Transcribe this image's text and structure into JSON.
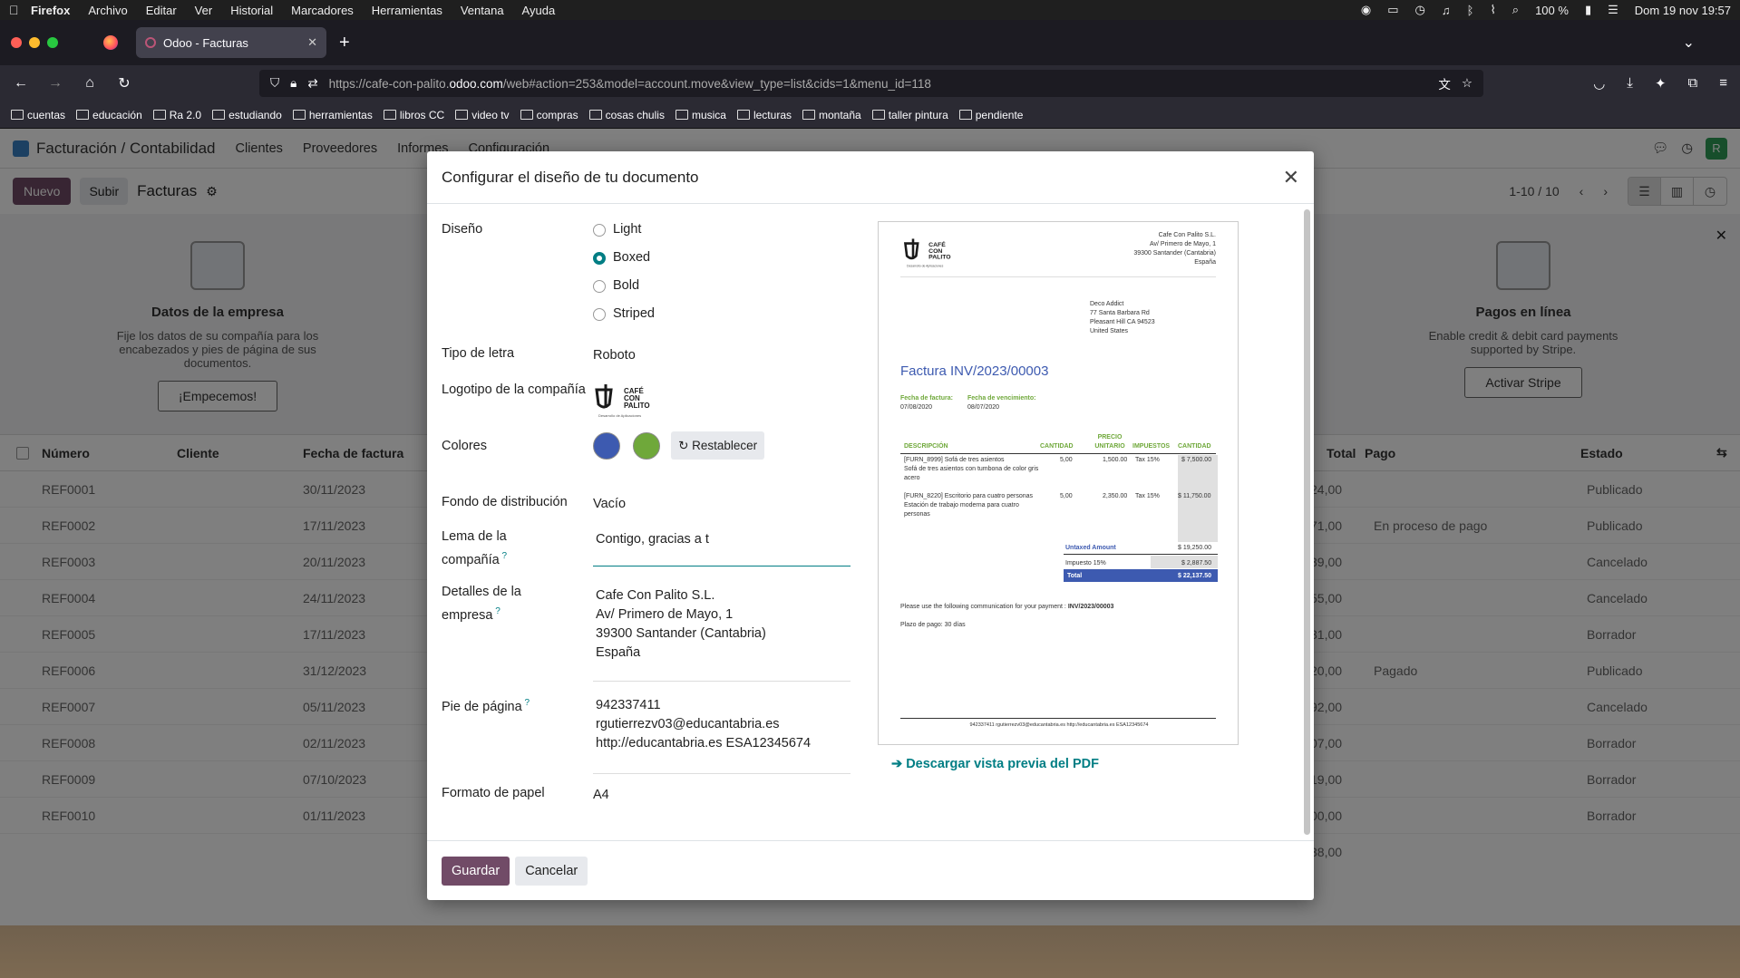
{
  "menubar": {
    "app": "Firefox",
    "items": [
      "Archivo",
      "Editar",
      "Ver",
      "Historial",
      "Marcadores",
      "Herramientas",
      "Ventana",
      "Ayuda"
    ],
    "battery": "100 %",
    "datetime": "Dom 19 nov  19:57"
  },
  "browser": {
    "tab_title": "Odoo - Facturas",
    "url_prefix": "https://cafe-con-palito.",
    "url_host": "odoo.com",
    "url_rest": "/web#action=253&model=account.move&view_type=list&cids=1&menu_id=118",
    "bookmarks": [
      "cuentas",
      "educación",
      "Ra 2.0",
      "estudiando",
      "herramientas",
      "libros CC",
      "video tv",
      "compras",
      "cosas chulis",
      "musica",
      "lecturas",
      "montaña",
      "taller pintura",
      "pendiente"
    ]
  },
  "odoo": {
    "app_title": "Facturación / Contabilidad",
    "menu": [
      "Clientes",
      "Proveedores",
      "Informes",
      "Configuración"
    ],
    "avatar": "R",
    "new_label": "Nuevo",
    "upload_label": "Subir",
    "view_title": "Facturas",
    "pager": "1-10 / 10",
    "onboarding": {
      "company_title": "Datos de la empresa",
      "company_text": "Fije los datos de su compañía para los encabezados y pies de página de sus documentos.",
      "company_button": "¡Empecemos!",
      "payments_title": "Pagos en línea",
      "payments_text": "Enable credit & debit card payments supported by Stripe.",
      "payments_button": "Activar Stripe"
    },
    "columns": {
      "number": "Número",
      "customer": "Cliente",
      "date": "Fecha de factura",
      "total": "Total",
      "payment": "Pago",
      "state": "Estado"
    },
    "rows": [
      {
        "ref": "REF0001",
        "date": "30/11/2023",
        "total": "24,00",
        "state": "Publicado"
      },
      {
        "ref": "REF0002",
        "date": "17/11/2023",
        "total": "71,00",
        "state": "Publicado",
        "payment": "En proceso de pago"
      },
      {
        "ref": "REF0003",
        "date": "20/11/2023",
        "total": "39,00",
        "state": "Cancelado"
      },
      {
        "ref": "REF0004",
        "date": "24/11/2023",
        "total": "55,00",
        "state": "Cancelado"
      },
      {
        "ref": "REF0005",
        "date": "17/11/2023",
        "total": "31,00",
        "state": "Borrador"
      },
      {
        "ref": "REF0006",
        "date": "31/12/2023",
        "total": "20,00",
        "state": "Publicado",
        "payment": "Pagado"
      },
      {
        "ref": "REF0007",
        "date": "05/11/2023",
        "total": "92,00",
        "state": "Cancelado"
      },
      {
        "ref": "REF0008",
        "date": "02/11/2023",
        "total": "07,00",
        "state": "Borrador"
      },
      {
        "ref": "REF0009",
        "date": "07/10/2023",
        "total": "19,00",
        "state": "Borrador"
      },
      {
        "ref": "REF0010",
        "date": "01/11/2023",
        "total": "00,00",
        "state": "Borrador"
      }
    ],
    "sum_total": "38,00"
  },
  "modal": {
    "title": "Configurar el diseño de tu documento",
    "labels": {
      "design": "Diseño",
      "font": "Tipo de letra",
      "logo": "Logotipo de la compañía",
      "colors": "Colores",
      "layout_bg": "Fondo de distribución",
      "tagline": "Lema de la compañía",
      "company_details": "Detalles de la empresa",
      "footer": "Pie de página",
      "paper": "Formato de papel"
    },
    "design_options": [
      "Light",
      "Boxed",
      "Bold",
      "Striped"
    ],
    "design_selected": "Boxed",
    "font_value": "Roboto",
    "color_primary": "#3d5ab0",
    "color_secondary": "#6fa83a",
    "reset_label": "Restablecer",
    "layout_bg_value": "Vacío",
    "tagline_value": "Contigo, gracias a t",
    "company_details_lines": [
      "Cafe Con Palito S.L.",
      "Av/ Primero de Mayo, 1",
      "39300 Santander (Cantabria)",
      "España"
    ],
    "footer_lines": [
      "942337411",
      "rgutierrezv03@educantabria.es",
      "http://educantabria.es ESA12345674"
    ],
    "paper_value": "A4",
    "download_label": "Descargar vista previa del PDF",
    "save_label": "Guardar",
    "cancel_label": "Cancelar"
  },
  "preview": {
    "logo_lines": [
      "CAFÉ",
      "CON",
      "PALITO"
    ],
    "logo_sub": "Desarrollo de Aplicaciones",
    "company_lines": [
      "Cafe Con Palito S.L.",
      "Av/ Primero de Mayo, 1",
      "39300 Santander (Cantabria)",
      "España"
    ],
    "customer_lines": [
      "Deco Addict",
      "77 Santa Barbara Rd",
      "Pleasant Hill CA 94523",
      "United States"
    ],
    "invoice_title": "Factura INV/2023/00003",
    "invoice_date_label": "Fecha de factura:",
    "invoice_date": "07/08/2020",
    "due_date_label": "Fecha de vencimiento:",
    "due_date": "08/07/2020",
    "columns": [
      "DESCRIPCIÓN",
      "CANTIDAD",
      "PRECIO UNITARIO",
      "IMPUESTOS",
      "CANTIDAD"
    ],
    "lines": [
      {
        "desc": "[FURN_8999] Sofá de tres asientos",
        "sub": "Sofá de tres asientos con tumbona de color gris acero",
        "qty": "5,00",
        "price": "1,500.00",
        "tax": "Tax 15%",
        "amount": "$ 7,500.00"
      },
      {
        "desc": "[FURN_8220] Escritorio para cuatro personas",
        "sub": "Estación de trabajo moderna para cuatro personas",
        "qty": "5,00",
        "price": "2,350.00",
        "tax": "Tax 15%",
        "amount": "$ 11,750.00"
      }
    ],
    "untaxed_label": "Untaxed Amount",
    "untaxed_value": "$ 19,250.00",
    "tax_label": "Impuesto 15%",
    "tax_value": "$ 2,887.50",
    "total_label": "Total",
    "total_value": "$ 22,137.50",
    "communication_prefix": "Please use the following communication for your payment :",
    "communication_ref": "INV/2023/00003",
    "payment_terms": "Plazo de pago: 30 días",
    "footer": "942337411 rgutierrezv03@educantabria.es http://educantabria.es ESA12345674"
  }
}
